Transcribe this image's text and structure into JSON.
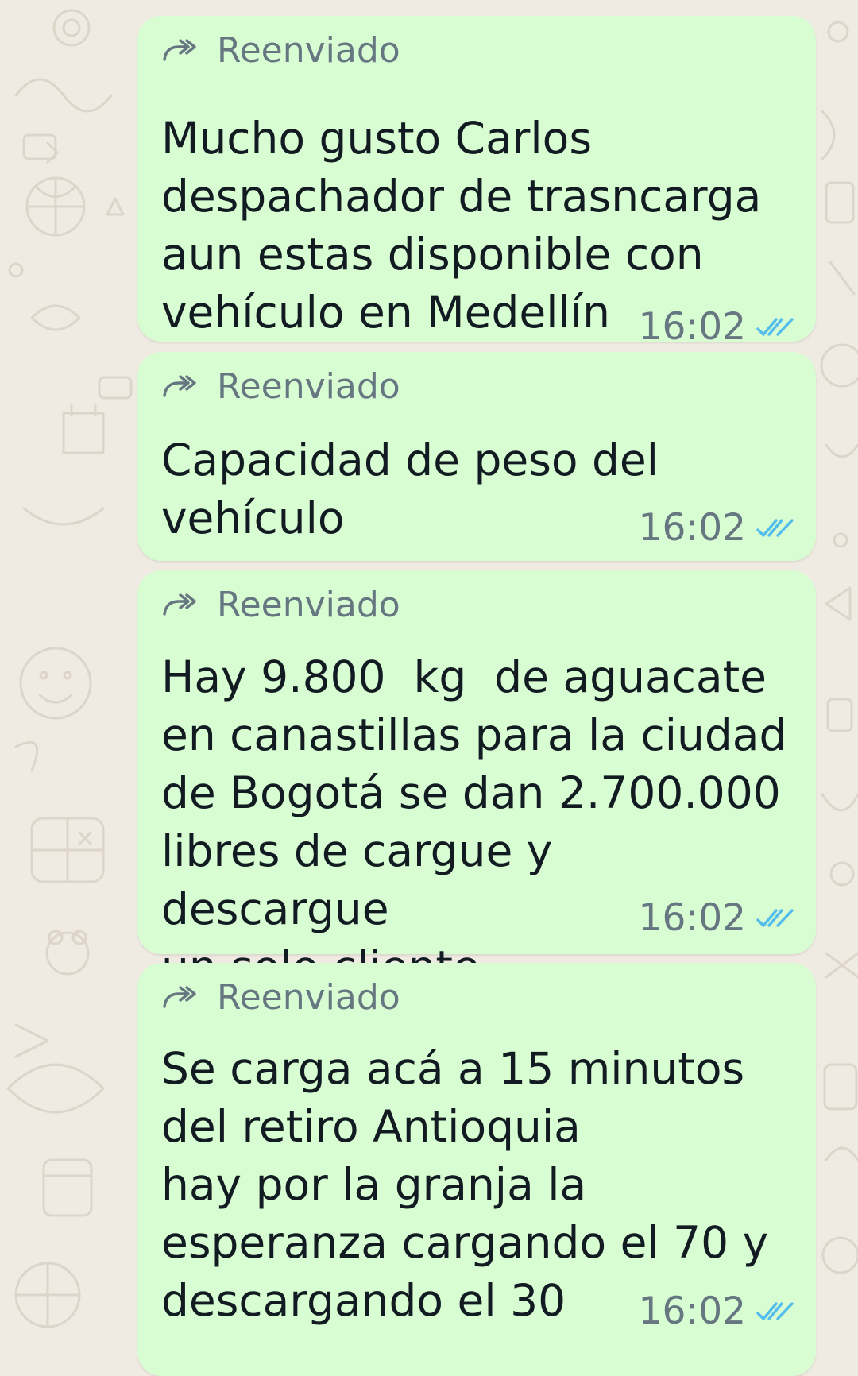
{
  "theme": {
    "background": "#efeae2",
    "bubble_outgoing": "#d9fdd3",
    "text_primary": "#111b21",
    "text_secondary": "#667781",
    "read_tick": "#53bdeb"
  },
  "messages": [
    {
      "forwarded_label": "Reenviado",
      "text": "Mucho gusto Carlos\ndespachador de trasncarga\naun estas disponible con\nvehículo en Medellín",
      "time": "16:02",
      "status_icon": "double-check-read-icon"
    },
    {
      "forwarded_label": "Reenviado",
      "text": "Capacidad de peso del\nvehículo",
      "time": "16:02",
      "status_icon": "double-check-read-icon"
    },
    {
      "forwarded_label": "Reenviado",
      "text": "Hay 9.800  kg  de aguacate\nen canastillas para la ciudad\nde Bogotá se dan 2.700.000\nlibres de cargue y descargue\nun solo cliente",
      "time": "16:02",
      "status_icon": "double-check-read-icon"
    },
    {
      "forwarded_label": "Reenviado",
      "text": "Se carga acá a 15 minutos\ndel retiro Antioquia\nhay por la granja la\nesperanza cargando el 70 y\ndescargando el 30",
      "time": "16:02",
      "status_icon": "double-check-read-icon"
    }
  ]
}
